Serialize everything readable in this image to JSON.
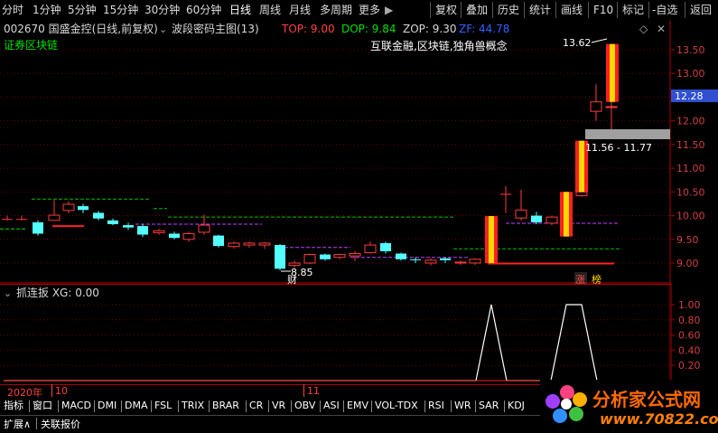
{
  "toolbar": {
    "periods": [
      "分时",
      "1分钟",
      "5分钟",
      "15分钟",
      "30分钟",
      "60分钟",
      "日线",
      "周线",
      "月线",
      "多周期",
      "更多"
    ],
    "active_period": "日线",
    "right": [
      "复权",
      "叠加",
      "历史",
      "统计",
      "画线",
      "F10",
      "标记",
      "-自选",
      "返回"
    ]
  },
  "header": {
    "stock": "002670 国盛金控(日线,前复权)",
    "indicator": "波段密码主图(13)",
    "top_label": "TOP: 9.00",
    "dop_label": "DOP: 9.84",
    "zop_label": "ZOP: 9.30",
    "zf_label": "ZF: 44.78",
    "concept": "证券区块链",
    "concept2": "互联金融,区块链,独角兽概念"
  },
  "annotations": {
    "high": "13.62",
    "low": "8.85",
    "range": "11.56 - 11.77",
    "cai": "财",
    "zhang": "涨",
    "bang": "榜"
  },
  "price_axis": {
    "ticks": [
      "13.50",
      "13.00",
      "12.50",
      "12.00",
      "11.50",
      "11.00",
      "10.50",
      "10.00",
      "9.50",
      "9.00"
    ],
    "current": "12.28"
  },
  "sub_indicator": {
    "title": "抓连扳 XG: 0.00",
    "ticks": [
      "1.00",
      "0.80",
      "0.60",
      "0.40",
      "0.20"
    ]
  },
  "dates": {
    "year": "2020年",
    "m1": "10",
    "m2": "11"
  },
  "tabs": [
    "指标",
    "窗口",
    "MACD",
    "DMI",
    "DMA",
    "FSL",
    "TRIX",
    "BRAR",
    "CR",
    "VR",
    "OBV",
    "ASI",
    "EMV",
    "VOL-TDX",
    "RSI",
    "WR",
    "SAR",
    "KDJ"
  ],
  "bottom": {
    "expand": "扩展∧",
    "quote": "关联报价"
  },
  "logo": {
    "name": "分析家公式网",
    "url": "www.70822.com"
  },
  "colors": {
    "up": "#ff3b3b",
    "down": "#54ffff",
    "green": "#00d000",
    "purple": "#c040ff",
    "yellow": "#ffd800"
  }
}
